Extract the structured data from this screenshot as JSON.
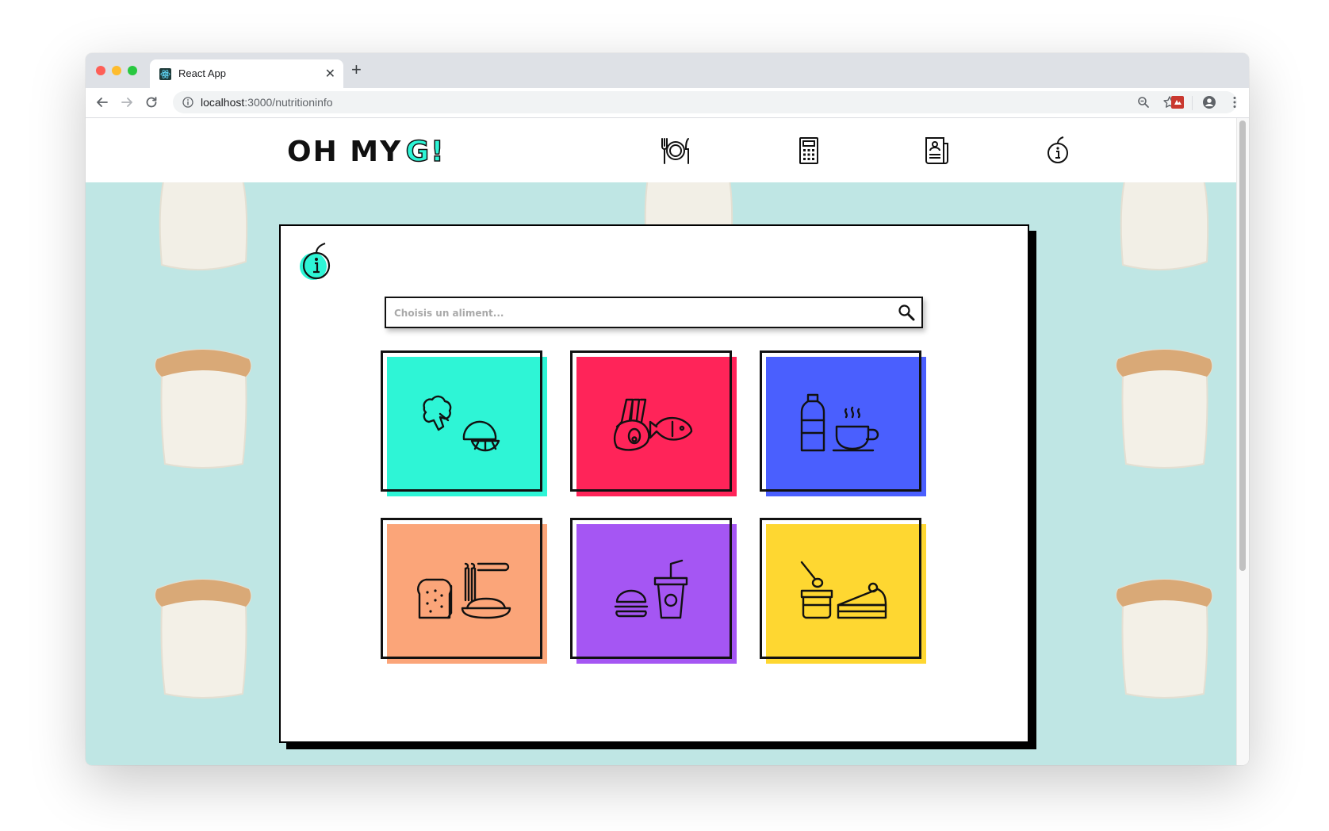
{
  "browser": {
    "tab_title": "React App",
    "url_host": "localhost",
    "url_path": ":3000/nutritioninfo"
  },
  "header": {
    "logo_text": "OH MY",
    "logo_letter": "G!",
    "nav_icons": [
      "meal-plate-icon",
      "calculator-icon",
      "document-icon",
      "nutrition-info-icon"
    ]
  },
  "search": {
    "placeholder": "Choisis un aliment..."
  },
  "colors": {
    "tile_1": "#2ef5d6",
    "tile_2": "#ff2459",
    "tile_3": "#4a5ffe",
    "tile_4": "#fba579",
    "tile_5": "#a556f3",
    "tile_6": "#fed731",
    "hero_background": "#bfe6e4"
  },
  "categories": [
    {
      "icon": "vegetables-fruits-icon"
    },
    {
      "icon": "meat-fish-icon"
    },
    {
      "icon": "drinks-icon"
    },
    {
      "icon": "bread-pasta-icon"
    },
    {
      "icon": "fastfood-icon"
    },
    {
      "icon": "desserts-icon"
    }
  ]
}
